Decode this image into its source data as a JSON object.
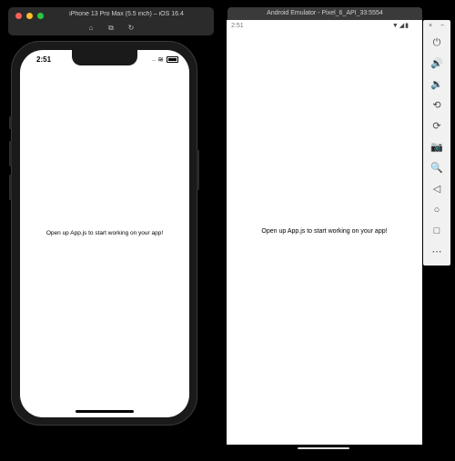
{
  "ios_simulator": {
    "window_title": "iPhone 13 Pro Max (5.5 inch) – iOS 16.4",
    "toolbar": [
      {
        "icon": "home-icon",
        "glyph": "⌂"
      },
      {
        "icon": "screenshot-icon",
        "glyph": "⧉"
      },
      {
        "icon": "rotate-icon",
        "glyph": "↻"
      }
    ],
    "status_time": "2:51",
    "status_signal": "....",
    "status_wifi": "≋",
    "app_text": "Open up App.js to start working on your app!"
  },
  "android_emulator": {
    "window_title": "Android Emulator - Pixel_6_API_33:5554",
    "status_time": "2:51",
    "status_icons": "▼◢▮",
    "app_text": "Open up App.js to start working on your app!",
    "toolbar": {
      "close_glyph": "×",
      "minimize_glyph": "−",
      "buttons": [
        {
          "name": "power-icon",
          "glyph": "⏻"
        },
        {
          "name": "volume-up-icon",
          "glyph": "🔊"
        },
        {
          "name": "volume-down-icon",
          "glyph": "🔉"
        },
        {
          "name": "rotate-left-icon",
          "glyph": "⟲"
        },
        {
          "name": "rotate-right-icon",
          "glyph": "⟳"
        },
        {
          "name": "camera-icon",
          "glyph": "📷"
        },
        {
          "name": "zoom-icon",
          "glyph": "🔍"
        },
        {
          "name": "back-icon",
          "glyph": "◁"
        },
        {
          "name": "home-icon",
          "glyph": "○"
        },
        {
          "name": "overview-icon",
          "glyph": "□"
        },
        {
          "name": "more-icon",
          "glyph": "⋯"
        }
      ]
    }
  }
}
